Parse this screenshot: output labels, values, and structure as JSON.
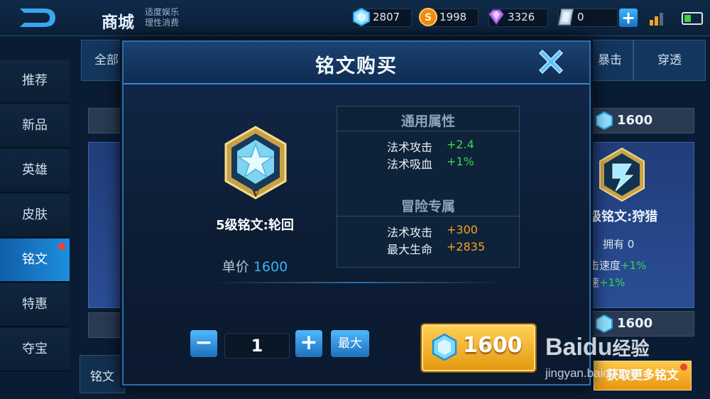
{
  "header": {
    "title": "商城",
    "subtitle_line1": "适度娱乐",
    "subtitle_line2": "理性消费",
    "currencies": [
      {
        "icon": "diamond-icon",
        "value": "2807"
      },
      {
        "icon": "gold-coin-icon",
        "value": "1998"
      },
      {
        "icon": "purple-gem-icon",
        "value": "3326"
      },
      {
        "icon": "voucher-icon",
        "value": "0"
      }
    ],
    "add_label": "+"
  },
  "sidebar": {
    "items": [
      {
        "label": "推荐"
      },
      {
        "label": "新品"
      },
      {
        "label": "英雄"
      },
      {
        "label": "皮肤"
      },
      {
        "label": "铭文",
        "active": true
      },
      {
        "label": "特惠"
      },
      {
        "label": "夺宝"
      }
    ]
  },
  "background": {
    "tab_all": "全部",
    "tab_crit": "暴击",
    "tab_pierce": "穿透",
    "right_price_1": "1600",
    "right_card_name": "级铭文:狩猎",
    "right_owned": "拥有 0",
    "right_attr1_name": "击速度",
    "right_attr1_val": "+1%",
    "right_attr2_name": "速",
    "right_attr2_val": "+1%",
    "right_price_2": "1600",
    "bottom_label": "铭文",
    "more_button": "获取更多铭文"
  },
  "modal": {
    "title": "铭文购买",
    "item_name": "5级铭文:轮回",
    "price_label": "单价",
    "price_value": "1600",
    "general_header": "通用属性",
    "general_attrs": [
      {
        "name": "法术攻击",
        "value": "+2.4"
      },
      {
        "name": "法术吸血",
        "value": "+1%"
      }
    ],
    "adventure_header": "冒险专属",
    "adventure_attrs": [
      {
        "name": "法术攻击",
        "value": "+300"
      },
      {
        "name": "最大生命",
        "value": "+2835"
      }
    ],
    "quantity": "1",
    "minus_label": "−",
    "plus_label": "+",
    "max_label": "最大",
    "buy_price": "1600"
  },
  "watermark": {
    "brand": "Bai",
    "brand2": "du",
    "brand3": "经验",
    "url": "jingyan.baidu.com"
  }
}
